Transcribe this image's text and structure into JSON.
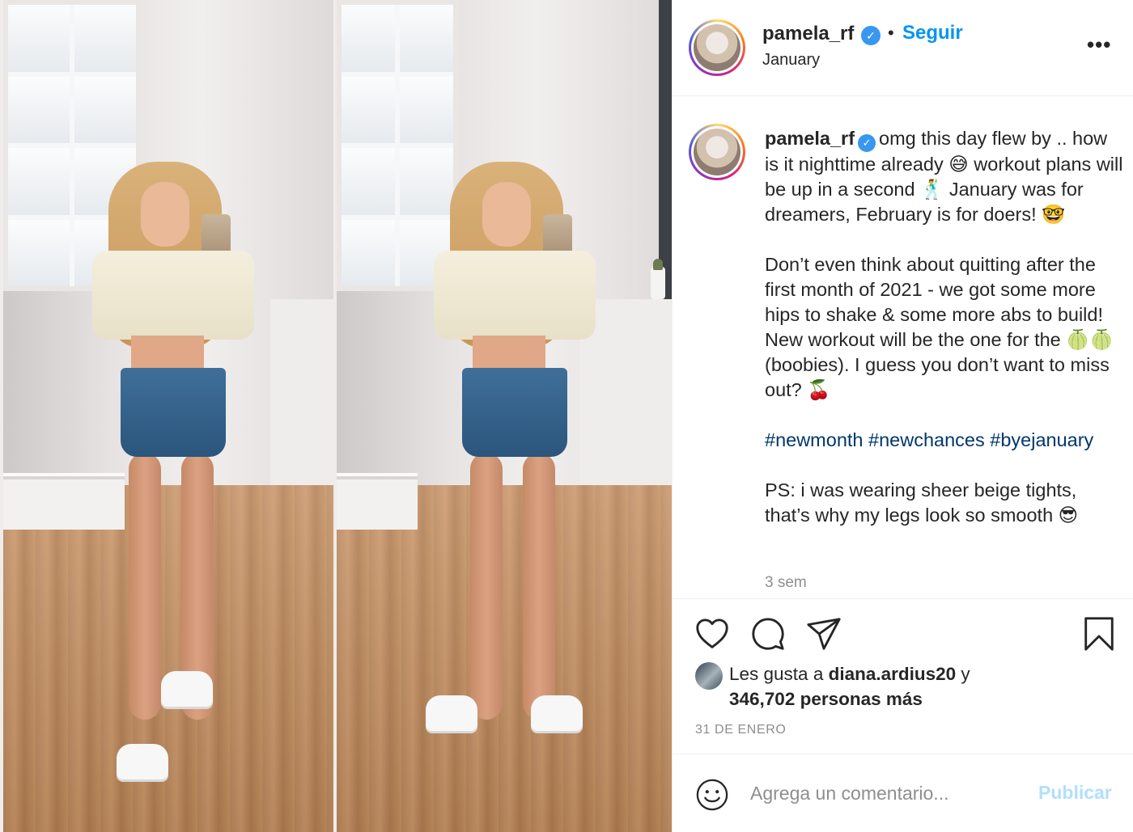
{
  "post": {
    "username": "pamela_rf",
    "verified_mark": "✓",
    "separator": "•",
    "follow_label": "Seguir",
    "location": "January",
    "more_label": "•••"
  },
  "caption": {
    "username": "pamela_rf",
    "paragraph1": "omg this day flew by .. how is it nighttime already 😅 workout plans will be up in a second 🕺 January was for dreamers, February is for doers! 🤓",
    "paragraph2": "Don’t even think about quitting after the first month of 2021 - we got some more hips to shake & some more abs to build! New workout will be the one for the 🍈🍈 (boobies). I guess you don’t want to miss out? 🍒",
    "hashtags": "#newmonth #newchances #byejanuary",
    "paragraph3": "PS: i was wearing sheer beige tights, that’s why my legs look so smooth 😎",
    "time_ago": "3 sem"
  },
  "likes": {
    "prefix": "Les gusta a ",
    "first_user": "diana.ardius20",
    "conjunction": " y",
    "others": "346,702 personas más"
  },
  "date": "31 DE ENERO",
  "comment": {
    "placeholder": "Agrega un comentario...",
    "publish_label": "Publicar"
  },
  "icons": {
    "like": "heart-icon",
    "comment": "comment-icon",
    "share": "paper-plane-icon",
    "save": "bookmark-icon",
    "emoji": "emoji-smile-icon",
    "more": "more-options-icon"
  },
  "colors": {
    "accent": "#0095f6",
    "publish_disabled": "#b2dffc",
    "hashtag": "#00376b",
    "muted": "#8e8e8e",
    "verified": "#3897f0"
  }
}
